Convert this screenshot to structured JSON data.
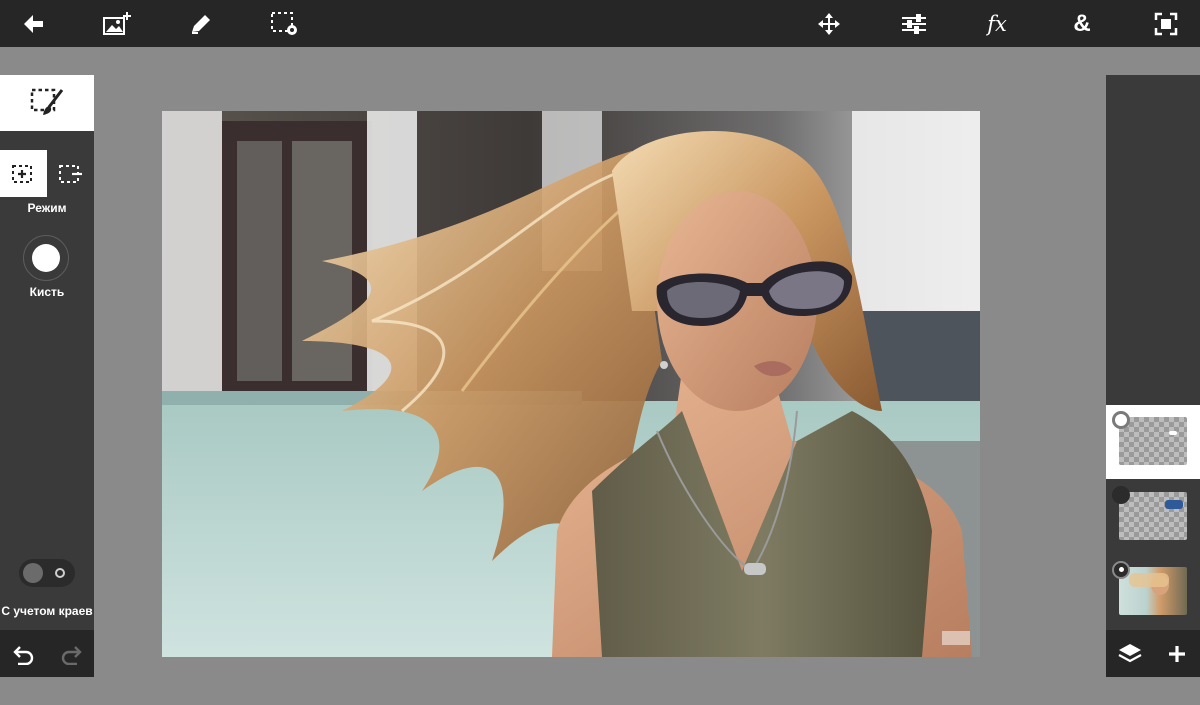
{
  "toolbar": {
    "left_icons": [
      "back-arrow-icon",
      "add-image-icon",
      "pencil-icon",
      "selection-settings-icon"
    ],
    "right_icons": [
      "move-icon",
      "adjustments-icon",
      "fx-icon",
      "blend-icon",
      "fit-screen-icon"
    ],
    "fx_label": "fx",
    "blend_label": "&"
  },
  "left_panel": {
    "tool_icon": "selection-brush-icon",
    "mode_label": "Режим",
    "brush_label": "Кисть",
    "edge_label": "С учетом краев",
    "edge_toggle_on": false
  },
  "right_panel": {
    "layers": [
      {
        "name": "layer-1",
        "selected": true
      },
      {
        "name": "layer-2",
        "selected": false
      },
      {
        "name": "layer-3",
        "selected": false
      }
    ]
  },
  "colors": {
    "toolbar_bg": "#262626",
    "panel_bg": "#3a3a3a",
    "workspace_bg": "#8a8a8a",
    "active_white": "#ffffff"
  }
}
